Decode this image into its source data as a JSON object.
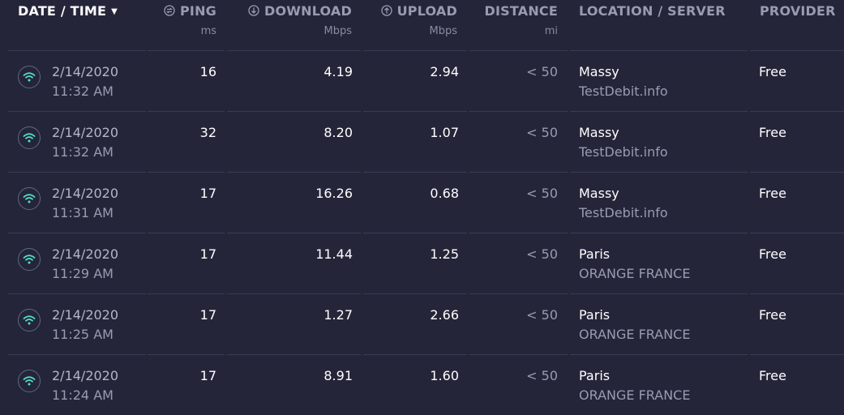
{
  "header": {
    "datetime": {
      "label": "DATE / TIME",
      "sort_icon": "caret-down-icon"
    },
    "ping": {
      "label": "PING",
      "unit": "ms",
      "icon": "ping-icon"
    },
    "download": {
      "label": "DOWNLOAD",
      "unit": "Mbps",
      "icon": "download-arrow-icon"
    },
    "upload": {
      "label": "UPLOAD",
      "unit": "Mbps",
      "icon": "upload-arrow-icon"
    },
    "distance": {
      "label": "DISTANCE",
      "unit": "mi"
    },
    "location": {
      "label": "LOCATION / SERVER"
    },
    "provider": {
      "label": "PROVIDER"
    }
  },
  "colors": {
    "background": "#25253a",
    "wifi_icon": "#4fe3c6",
    "divider": "#3a3a52"
  },
  "results": [
    {
      "date": "2/14/2020",
      "time": "11:32 AM",
      "ping": "16",
      "download": "4.19",
      "upload": "2.94",
      "distance": "< 50",
      "city": "Massy",
      "server": "TestDebit.info",
      "provider": "Free"
    },
    {
      "date": "2/14/2020",
      "time": "11:32 AM",
      "ping": "32",
      "download": "8.20",
      "upload": "1.07",
      "distance": "< 50",
      "city": "Massy",
      "server": "TestDebit.info",
      "provider": "Free"
    },
    {
      "date": "2/14/2020",
      "time": "11:31 AM",
      "ping": "17",
      "download": "16.26",
      "upload": "0.68",
      "distance": "< 50",
      "city": "Massy",
      "server": "TestDebit.info",
      "provider": "Free"
    },
    {
      "date": "2/14/2020",
      "time": "11:29 AM",
      "ping": "17",
      "download": "11.44",
      "upload": "1.25",
      "distance": "< 50",
      "city": "Paris",
      "server": "ORANGE FRANCE",
      "provider": "Free"
    },
    {
      "date": "2/14/2020",
      "time": "11:25 AM",
      "ping": "17",
      "download": "1.27",
      "upload": "2.66",
      "distance": "< 50",
      "city": "Paris",
      "server": "ORANGE FRANCE",
      "provider": "Free"
    },
    {
      "date": "2/14/2020",
      "time": "11:24 AM",
      "ping": "17",
      "download": "8.91",
      "upload": "1.60",
      "distance": "< 50",
      "city": "Paris",
      "server": "ORANGE FRANCE",
      "provider": "Free"
    }
  ]
}
